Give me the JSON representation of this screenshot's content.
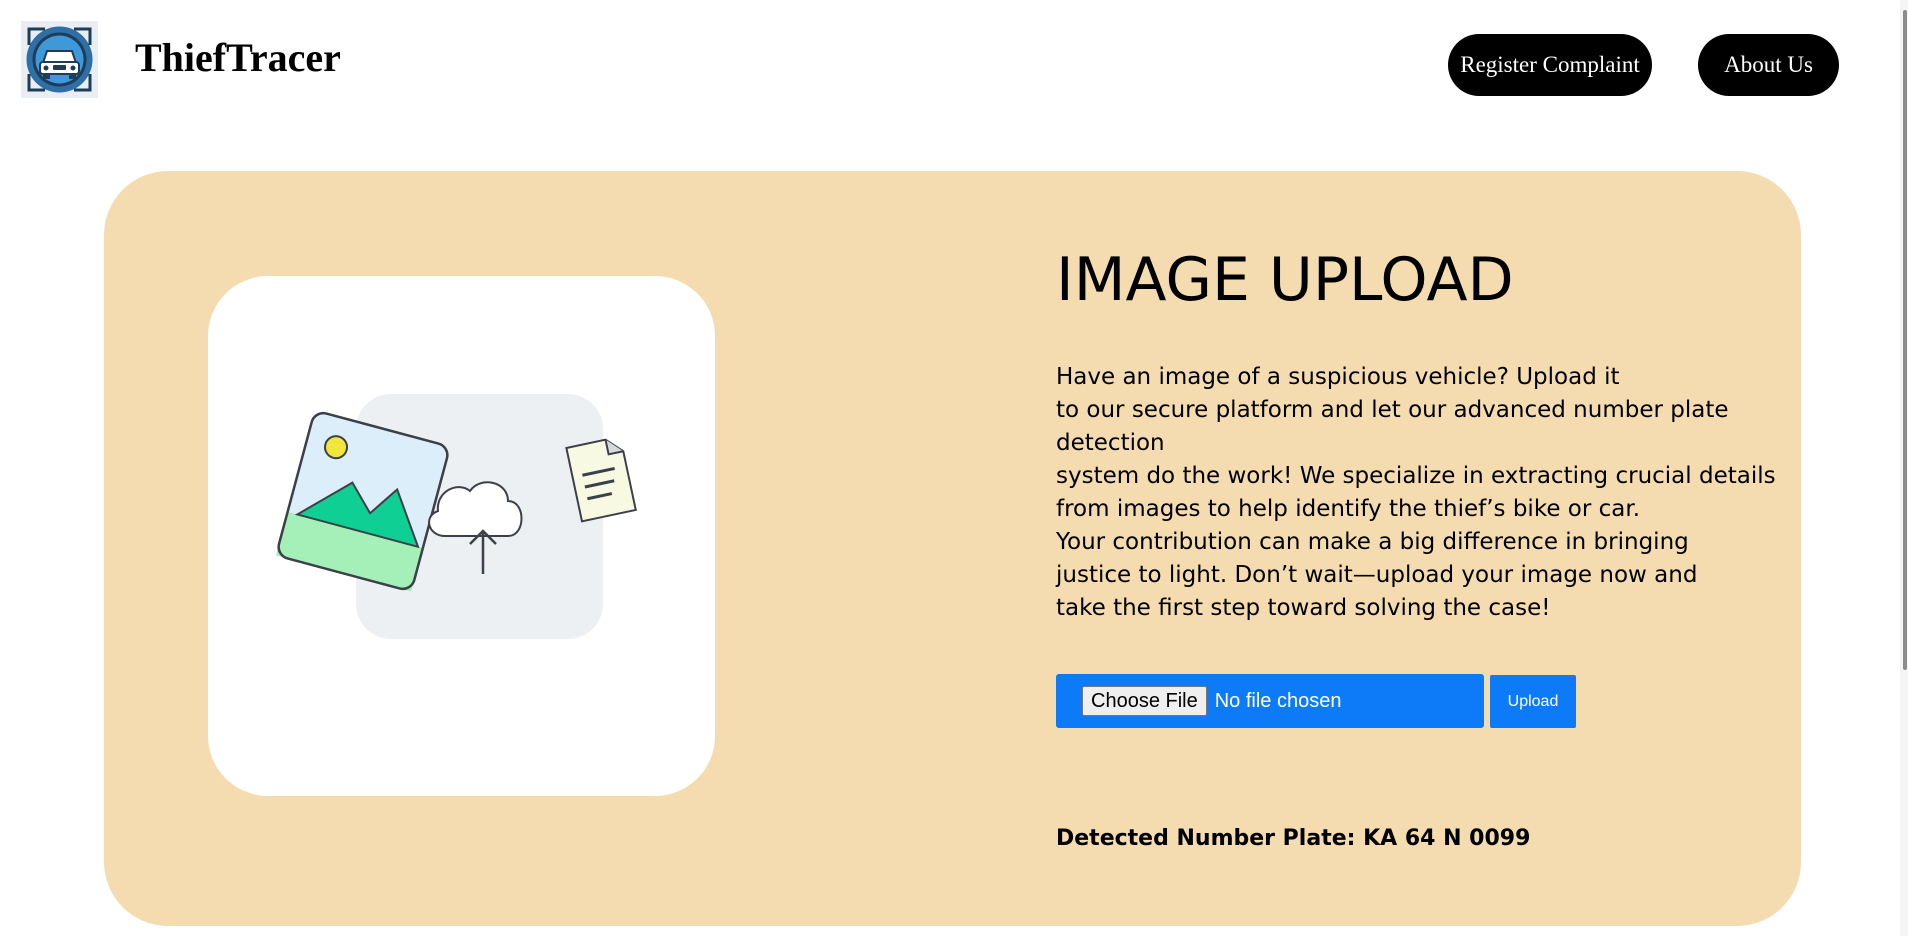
{
  "header": {
    "brand": "ThiefTracer",
    "nav": {
      "register": "Register Complaint",
      "about": "About Us"
    }
  },
  "main": {
    "title": "IMAGE UPLOAD",
    "description_lines": [
      "Have an image of a suspicious vehicle? Upload it",
      "to our secure platform and let our advanced number plate",
      "detection",
      "system do the work! We specialize in extracting crucial details",
      "from images to help identify the thief’s bike or car.",
      "Your contribution can make a big difference in bringing",
      "justice to light. Don’t wait—upload your image now and",
      "take the first step toward solving the case!"
    ],
    "file_input": {
      "button_label": "Choose File",
      "status": "No file chosen"
    },
    "upload_label": "Upload",
    "result": "Detected Number Plate: KA 64 N 0099"
  },
  "colors": {
    "panel": "#f4dcb0",
    "accent": "#0d7bf8",
    "nav_button": "#000000"
  },
  "icons": [
    "car-logo-icon",
    "image-icon",
    "cloud-upload-icon",
    "document-icon"
  ]
}
